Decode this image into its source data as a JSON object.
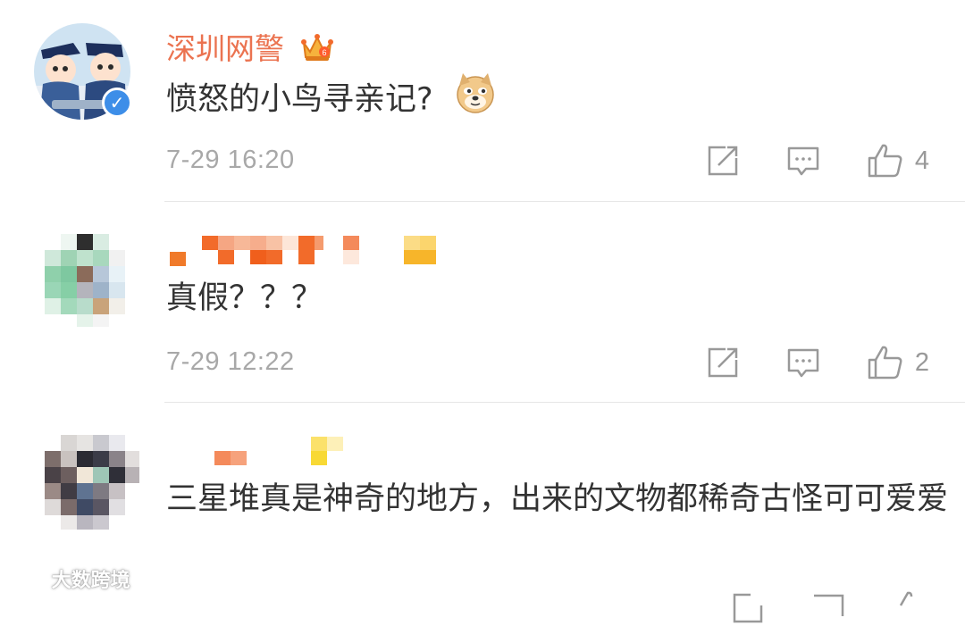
{
  "comments": [
    {
      "username": "深圳网警",
      "verified": true,
      "vip": true,
      "text": "愤怒的小鸟寻亲记?",
      "emoji": "doge",
      "time": "7-29 16:20",
      "likes": "4",
      "comments_count": ""
    },
    {
      "username": "",
      "username_hidden": true,
      "text": "真假？？？",
      "time": "7-29 12:22",
      "likes": "2",
      "comments_count": ""
    },
    {
      "username": "",
      "username_hidden": true,
      "text": "三星堆真是神奇的地方，出来的文物都稀奇古怪可可爱爱",
      "time": "",
      "likes": ""
    }
  ],
  "icons": {
    "repost": "repost-icon",
    "comment": "comment-icon",
    "like": "thumbs-up-icon",
    "vip": "crown-icon",
    "verified": "verified-v-icon"
  },
  "colors": {
    "username": "#eb7350",
    "text": "#333333",
    "meta": "#a8a8a8",
    "verified": "#3d8ee8"
  },
  "watermark": "大数跨境"
}
